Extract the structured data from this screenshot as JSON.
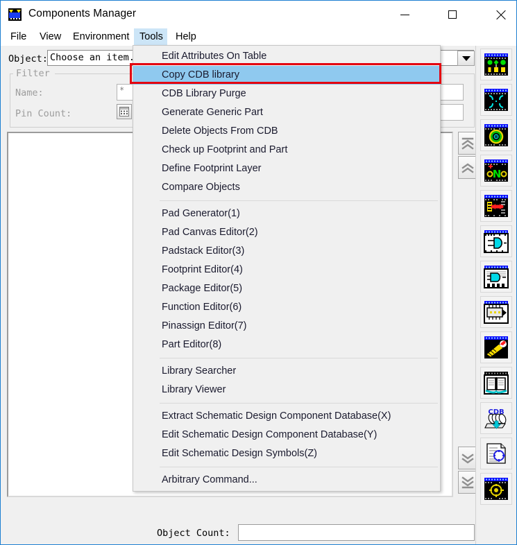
{
  "window": {
    "title": "Components Manager",
    "icon": "app-logo-icon",
    "controls": {
      "minimize": "minimize-icon",
      "maximize": "maximize-icon",
      "close": "close-icon"
    }
  },
  "menubar": {
    "items": [
      {
        "label": "File",
        "active": false
      },
      {
        "label": "View",
        "active": false
      },
      {
        "label": "Environment",
        "active": false
      },
      {
        "label": "Tools",
        "active": true
      },
      {
        "label": "Help",
        "active": false
      }
    ]
  },
  "form": {
    "object_label": "Object:",
    "object_value": "Choose an item.",
    "filter_legend": "Filter",
    "name_label": "Name:",
    "name_value": "*",
    "pin_count_label": "Pin Count:",
    "pin_count_value": "",
    "dropdown_icon": "chevron-down-icon"
  },
  "status": {
    "object_count_label": "Object Count:",
    "object_count_value": ""
  },
  "nav_buttons": [
    {
      "name": "scroll-top-button",
      "icon": "double-chevron-up-bar-icon"
    },
    {
      "name": "scroll-up-button",
      "icon": "double-chevron-up-icon"
    },
    {
      "name": "scroll-down-button",
      "icon": "double-chevron-down-icon"
    },
    {
      "name": "scroll-bottom-button",
      "icon": "double-chevron-down-bar-icon"
    }
  ],
  "toolbar": {
    "buttons": [
      {
        "name": "pad-generator-button",
        "icon": "pad-generator-icon"
      },
      {
        "name": "pad-canvas-editor-button",
        "icon": "pad-canvas-icon"
      },
      {
        "name": "padstack-editor-button",
        "icon": "padstack-icon"
      },
      {
        "name": "footprint-editor-button",
        "icon": "footprint-icon"
      },
      {
        "name": "package-editor-button",
        "icon": "package-icon"
      },
      {
        "name": "function-editor-button",
        "icon": "logic-gate-icon"
      },
      {
        "name": "pinassign-editor-button",
        "icon": "pinassign-icon"
      },
      {
        "name": "part-editor-button",
        "icon": "part-icon"
      },
      {
        "name": "library-searcher-button",
        "icon": "search-light-icon"
      },
      {
        "name": "library-viewer-button",
        "icon": "open-book-icon"
      },
      {
        "name": "cdb-library-button",
        "icon": "cdb-database-icon"
      },
      {
        "name": "edit-schematic-db-button",
        "icon": "document-symbol-icon"
      },
      {
        "name": "schematic-symbols-button",
        "icon": "symbol-editor-icon"
      }
    ]
  },
  "menu": {
    "name": "tools-menu",
    "groups": [
      {
        "items": [
          {
            "label": "Edit Attributes On Table",
            "selected": false
          },
          {
            "label": "Copy CDB library",
            "selected": true
          },
          {
            "label": "CDB Library Purge",
            "selected": false
          },
          {
            "label": "Generate Generic Part",
            "selected": false
          },
          {
            "label": "Delete Objects From CDB",
            "selected": false
          },
          {
            "label": "Check up Footprint and Part",
            "selected": false
          },
          {
            "label": "Define Footprint Layer",
            "selected": false
          },
          {
            "label": "Compare Objects",
            "selected": false
          }
        ]
      },
      {
        "items": [
          {
            "label": "Pad Generator(1)",
            "selected": false
          },
          {
            "label": "Pad Canvas Editor(2)",
            "selected": false
          },
          {
            "label": "Padstack Editor(3)",
            "selected": false
          },
          {
            "label": "Footprint Editor(4)",
            "selected": false
          },
          {
            "label": "Package Editor(5)",
            "selected": false
          },
          {
            "label": "Function Editor(6)",
            "selected": false
          },
          {
            "label": "Pinassign Editor(7)",
            "selected": false
          },
          {
            "label": "Part Editor(8)",
            "selected": false
          }
        ]
      },
      {
        "items": [
          {
            "label": "Library Searcher",
            "selected": false
          },
          {
            "label": "Library Viewer",
            "selected": false
          }
        ]
      },
      {
        "items": [
          {
            "label": "Extract Schematic Design Component Database(X)",
            "selected": false
          },
          {
            "label": "Edit Schematic Design Component Database(Y)",
            "selected": false
          },
          {
            "label": "Edit Schematic Design Symbols(Z)",
            "selected": false
          }
        ]
      },
      {
        "items": [
          {
            "label": "Arbitrary Command...",
            "selected": false
          }
        ]
      }
    ]
  },
  "annotation": {
    "highlight_box": "red-highlight-box",
    "highlight_color": "#e4000f",
    "selection_color": "#8fc9ef",
    "menubar_active_color": "#cce5f7",
    "window_border_color": "#1d7fd1"
  }
}
